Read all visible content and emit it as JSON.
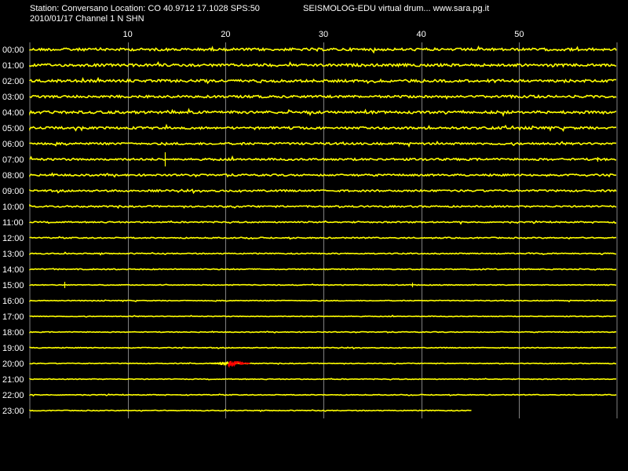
{
  "header": {
    "station_line": "Station: Conversano Location: CO 40.9712 17.1028 SPS:50",
    "date_line": "2010/01/17  Channel 1 N SHN",
    "app_line": "SEISMOLOG-EDU virtual drum... www.sara.pg.it"
  },
  "colors": {
    "background": "#000000",
    "trace": "#ffff00",
    "event": "#ff0000",
    "grid": "#808080",
    "text": "#ffffff"
  },
  "chart_data": {
    "type": "line",
    "title": "",
    "xlabel": "",
    "ylabel": "",
    "xlim": [
      0,
      60
    ],
    "x_ticks": [
      10,
      20,
      30,
      40,
      50
    ],
    "grid": true,
    "legend": "none",
    "rows": [
      {
        "label": "00:00",
        "noise": 1.0,
        "end_minute": 60
      },
      {
        "label": "01:00",
        "noise": 1.0,
        "end_minute": 60
      },
      {
        "label": "02:00",
        "noise": 1.0,
        "end_minute": 60
      },
      {
        "label": "03:00",
        "noise": 0.9,
        "end_minute": 60
      },
      {
        "label": "04:00",
        "noise": 1.0,
        "end_minute": 60
      },
      {
        "label": "05:00",
        "noise": 0.9,
        "end_minute": 60
      },
      {
        "label": "06:00",
        "noise": 0.8,
        "end_minute": 60
      },
      {
        "label": "07:00",
        "noise": 0.8,
        "end_minute": 60
      },
      {
        "label": "08:00",
        "noise": 0.7,
        "end_minute": 60
      },
      {
        "label": "09:00",
        "noise": 0.7,
        "end_minute": 60
      },
      {
        "label": "10:00",
        "noise": 0.6,
        "end_minute": 60
      },
      {
        "label": "11:00",
        "noise": 0.5,
        "end_minute": 60
      },
      {
        "label": "12:00",
        "noise": 0.45,
        "end_minute": 60
      },
      {
        "label": "13:00",
        "noise": 0.4,
        "end_minute": 60
      },
      {
        "label": "14:00",
        "noise": 0.4,
        "end_minute": 60
      },
      {
        "label": "15:00",
        "noise": 0.3,
        "end_minute": 60
      },
      {
        "label": "16:00",
        "noise": 0.3,
        "end_minute": 60
      },
      {
        "label": "17:00",
        "noise": 0.3,
        "end_minute": 60
      },
      {
        "label": "18:00",
        "noise": 0.3,
        "end_minute": 60
      },
      {
        "label": "19:00",
        "noise": 0.3,
        "end_minute": 60
      },
      {
        "label": "20:00",
        "noise": 0.3,
        "end_minute": 60
      },
      {
        "label": "21:00",
        "noise": 0.3,
        "end_minute": 60
      },
      {
        "label": "22:00",
        "noise": 0.3,
        "end_minute": 60
      },
      {
        "label": "23:00",
        "noise": 0.3,
        "end_minute": 45.2
      }
    ],
    "spikes": [
      {
        "row": 7,
        "minute": 13.8,
        "amplitude": 9
      },
      {
        "row": 7,
        "minute": 58.0,
        "amplitude": 3
      },
      {
        "row": 15,
        "minute": 3.5,
        "amplitude": 4
      },
      {
        "row": 15,
        "minute": 39.1,
        "amplitude": 3
      }
    ],
    "events": [
      {
        "row": 20,
        "start_minute": 18.5,
        "peak_minute": 20.3,
        "end_minute": 22.5,
        "amplitude": 4
      }
    ]
  }
}
